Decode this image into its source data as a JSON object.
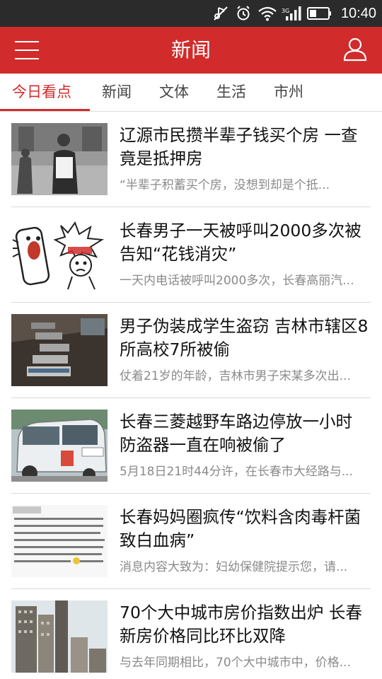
{
  "status_bar": {
    "time": "10:40",
    "network": "3G",
    "icons": [
      "mute-icon",
      "alarm-icon",
      "wifi-icon",
      "signal-icon",
      "battery-icon"
    ]
  },
  "app_bar": {
    "title": "新闻",
    "left_icon": "menu-icon",
    "right_icon": "user-icon",
    "background": "#d12b2b"
  },
  "tabs": [
    {
      "label": "今日看点",
      "active": true
    },
    {
      "label": "新闻",
      "active": false
    },
    {
      "label": "文体",
      "active": false
    },
    {
      "label": "生活",
      "active": false
    },
    {
      "label": "市州",
      "active": false
    }
  ],
  "news": [
    {
      "title": "辽源市民攒半辈子钱买个房 一查竟是抵押房",
      "summary": "“半辈子积蓄买个房，没想到却是个抵..."
    },
    {
      "title": "长春男子一天被呼叫2000多次被告知“花钱消灾”",
      "summary": "一天内电话被呼叫2000多次，长春高丽汽..."
    },
    {
      "title": "男子伪装成学生盗窃 吉林市辖区8所高校7所被偷",
      "summary": "仗着21岁的年龄，吉林市男子宋某多次出..."
    },
    {
      "title": "长春三菱越野车路边停放一小时防盗器一直在响被偷了",
      "summary": "5月18日21时44分许，在长春市大经路与..."
    },
    {
      "title": "长春妈妈圈疯传“饮料含肉毒杆菌致白血病”",
      "summary": "消息内容大致为：妇幼保健院提示您，请..."
    },
    {
      "title": "70个大中城市房价指数出炉 长春新房价格同比环比双降",
      "summary": "与去年同期相比，70个大中城市中，价格..."
    }
  ]
}
